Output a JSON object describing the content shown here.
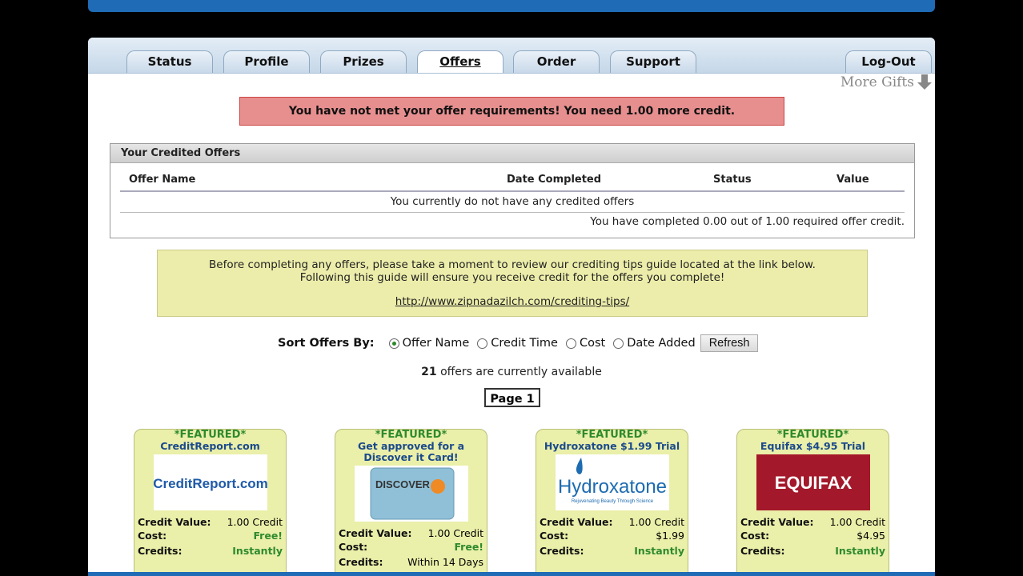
{
  "tabs": [
    {
      "label": "Status"
    },
    {
      "label": "Profile"
    },
    {
      "label": "Prizes"
    },
    {
      "label": "Offers"
    },
    {
      "label": "Order"
    },
    {
      "label": "Support"
    },
    {
      "label": "Log-Out"
    }
  ],
  "more_gifts": "More Gifts",
  "alert": "You have not met your offer requirements! You need 1.00 more credit.",
  "credited": {
    "heading": "Your Credited Offers",
    "columns": [
      "Offer Name",
      "Date Completed",
      "Status",
      "Value"
    ],
    "empty_text": "You currently do not have any credited offers",
    "completed_text": "You have completed 0.00 out of 1.00 required offer credit."
  },
  "tips": {
    "line1": "Before completing any offers, please take a moment to review our crediting tips guide located at the link below.",
    "line2": "Following this guide will ensure you receive credit for the offers you complete!",
    "link": "http://www.zipnadazilch.com/crediting-tips/"
  },
  "sort": {
    "label": "Sort Offers By:",
    "options": [
      "Offer Name",
      "Credit Time",
      "Cost",
      "Date Added"
    ],
    "selected": "Offer Name",
    "refresh": "Refresh"
  },
  "availability": {
    "count": "21",
    "text": " offers are currently available"
  },
  "page_label": "Page 1",
  "offers": [
    {
      "featured": "*FEATURED*",
      "title": "CreditReport.com",
      "logo_text": "CreditReport.com",
      "credit_value_label": "Credit Value:",
      "credit_value": "1.00 Credit",
      "cost_label": "Cost:",
      "cost": "Free!",
      "credits_label": "Credits:",
      "credits": "Instantly"
    },
    {
      "featured": "*FEATURED*",
      "title": "Get approved for a Discover it Card!",
      "logo_text": "DISCOVER",
      "credit_value_label": "Credit Value:",
      "credit_value": "1.00 Credit",
      "cost_label": "Cost:",
      "cost": "Free!",
      "credits_label": "Credits:",
      "credits": "Within 14 Days"
    },
    {
      "featured": "*FEATURED*",
      "title": "Hydroxatone $1.99 Trial",
      "logo_text": "Hydroxatone",
      "logo_sub": "Rejuvenating Beauty Through Science",
      "credit_value_label": "Credit Value:",
      "credit_value": "1.00 Credit",
      "cost_label": "Cost:",
      "cost": "$1.99",
      "credits_label": "Credits:",
      "credits": "Instantly"
    },
    {
      "featured": "*FEATURED*",
      "title": "Equifax $4.95 Trial",
      "logo_text": "EQUIFAX",
      "credit_value_label": "Credit Value:",
      "credit_value": "1.00 Credit",
      "cost_label": "Cost:",
      "cost": "$4.95",
      "credits_label": "Credits:",
      "credits": "Instantly"
    }
  ],
  "colors": {
    "brand_blue": "#1f6bb6",
    "alert_bg": "#e78f8f",
    "tips_bg": "#ecedaa",
    "card_bg": "#eaefa9",
    "featured_green": "#2e8a2e",
    "title_blue": "#1b4a8c"
  }
}
